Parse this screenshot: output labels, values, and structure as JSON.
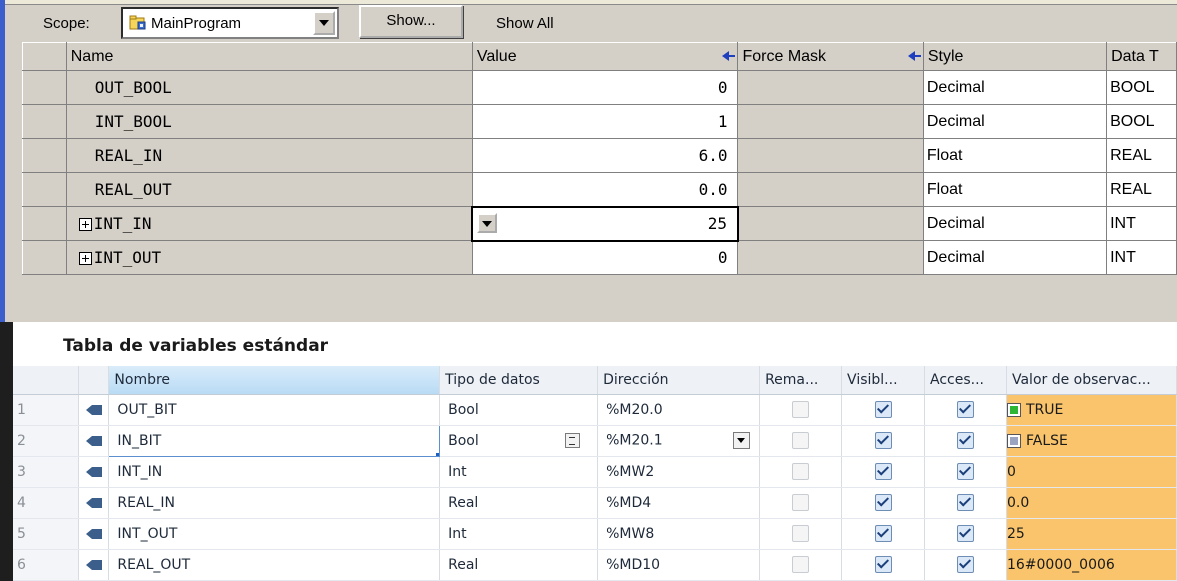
{
  "top_panel": {
    "scope_label": "Scope:",
    "scope_value": "MainProgram",
    "show_button": "Show...",
    "show_all": "Show All",
    "columns": [
      "Name",
      "Value",
      "Force Mask",
      "Style",
      "Data T"
    ],
    "rows": [
      {
        "name": "OUT_BOOL",
        "value": "0",
        "style": "Decimal",
        "type": "BOOL",
        "expandable": false
      },
      {
        "name": "INT_BOOL",
        "value": "1",
        "style": "Decimal",
        "type": "BOOL",
        "expandable": false
      },
      {
        "name": "REAL_IN",
        "value": "6.0",
        "style": "Float",
        "type": "REAL",
        "expandable": false
      },
      {
        "name": "REAL_OUT",
        "value": "0.0",
        "style": "Float",
        "type": "REAL",
        "expandable": false
      },
      {
        "name": "INT_IN",
        "value": "25",
        "style": "Decimal",
        "type": "INT",
        "expandable": true
      },
      {
        "name": "INT_OUT",
        "value": "0",
        "style": "Decimal",
        "type": "INT",
        "expandable": true
      }
    ]
  },
  "bottom_panel": {
    "title": "Tabla de variables estándar",
    "columns": [
      "Nombre",
      "Tipo de datos",
      "Dirección",
      "Rema...",
      "Visibl...",
      "Acces...",
      "Valor de observac..."
    ],
    "rows": [
      {
        "num": "1",
        "name": "OUT_BIT",
        "type": "Bool",
        "address": "%M20.0",
        "remanent": false,
        "visible": true,
        "accessible": true,
        "watch": "TRUE",
        "led": "green"
      },
      {
        "num": "2",
        "name": "IN_BIT",
        "type": "Bool",
        "address": "%M20.1",
        "remanent": false,
        "visible": true,
        "accessible": true,
        "watch": "FALSE",
        "led": "grey"
      },
      {
        "num": "3",
        "name": "INT_IN",
        "type": "Int",
        "address": "%MW2",
        "remanent": false,
        "visible": true,
        "accessible": true,
        "watch": "0",
        "led": ""
      },
      {
        "num": "4",
        "name": "REAL_IN",
        "type": "Real",
        "address": "%MD4",
        "remanent": false,
        "visible": true,
        "accessible": true,
        "watch": "0.0",
        "led": ""
      },
      {
        "num": "5",
        "name": "INT_OUT",
        "type": "Int",
        "address": "%MW8",
        "remanent": false,
        "visible": true,
        "accessible": true,
        "watch": "25",
        "led": ""
      },
      {
        "num": "6",
        "name": "REAL_OUT",
        "type": "Real",
        "address": "%MD10",
        "remanent": false,
        "visible": true,
        "accessible": true,
        "watch": "16#0000_0006",
        "led": ""
      }
    ]
  }
}
